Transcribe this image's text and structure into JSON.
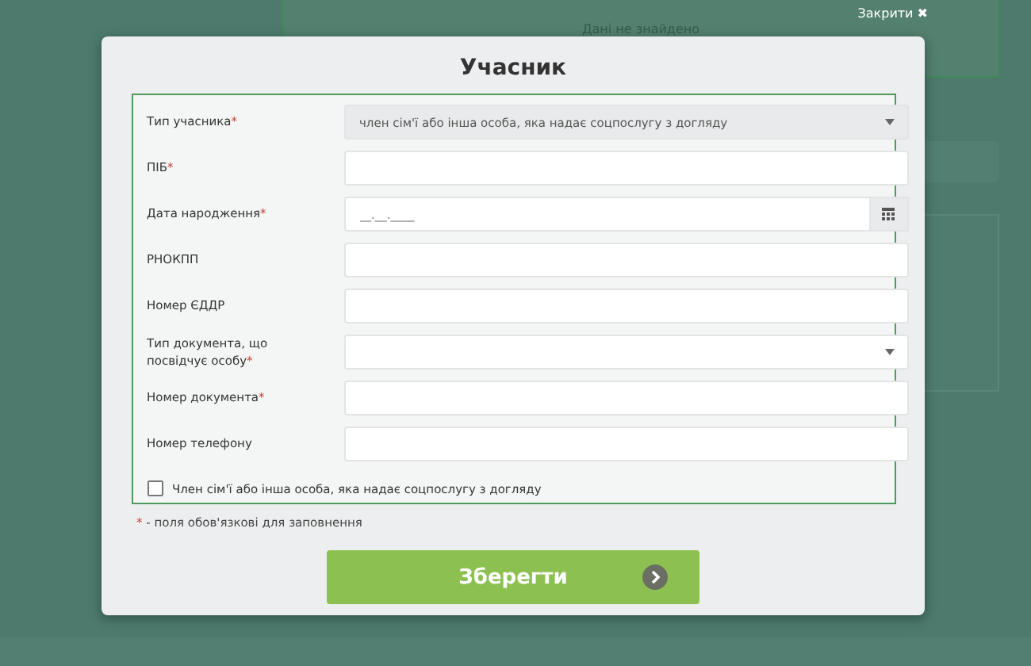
{
  "background": {
    "notice": "Дані не знайдено",
    "close": {
      "label": "Закрити",
      "icon": "✖"
    }
  },
  "modal": {
    "title": "Учасник",
    "fields": [
      {
        "kind": "select",
        "label": "Тип учасника",
        "required": true,
        "value": "член сім'ї або інша особа, яка надає соцпослугу з догляду",
        "disabled": true
      },
      {
        "kind": "text",
        "label": "ПІБ",
        "required": true
      },
      {
        "kind": "date",
        "label": "Дата народження",
        "required": true,
        "placeholder": "__.__.____"
      },
      {
        "kind": "text",
        "label": "РНОКПП",
        "required": false
      },
      {
        "kind": "text",
        "label": "Номер ЄДДР",
        "required": false
      },
      {
        "kind": "select",
        "label": "Тип документа, що посвідчує особу",
        "required": true,
        "disabled": false
      },
      {
        "kind": "text",
        "label": "Номер документа",
        "required": true
      },
      {
        "kind": "text",
        "label": "Номер телефону",
        "required": false
      }
    ],
    "checkbox": {
      "label": "Член сім'ї або інша особа, яка надає соцпослугу з догляду",
      "checked": false
    },
    "required_note": {
      "mark": "*",
      "text": " - поля обов'язкові для заповнення"
    },
    "save_button": "Зберегти"
  }
}
